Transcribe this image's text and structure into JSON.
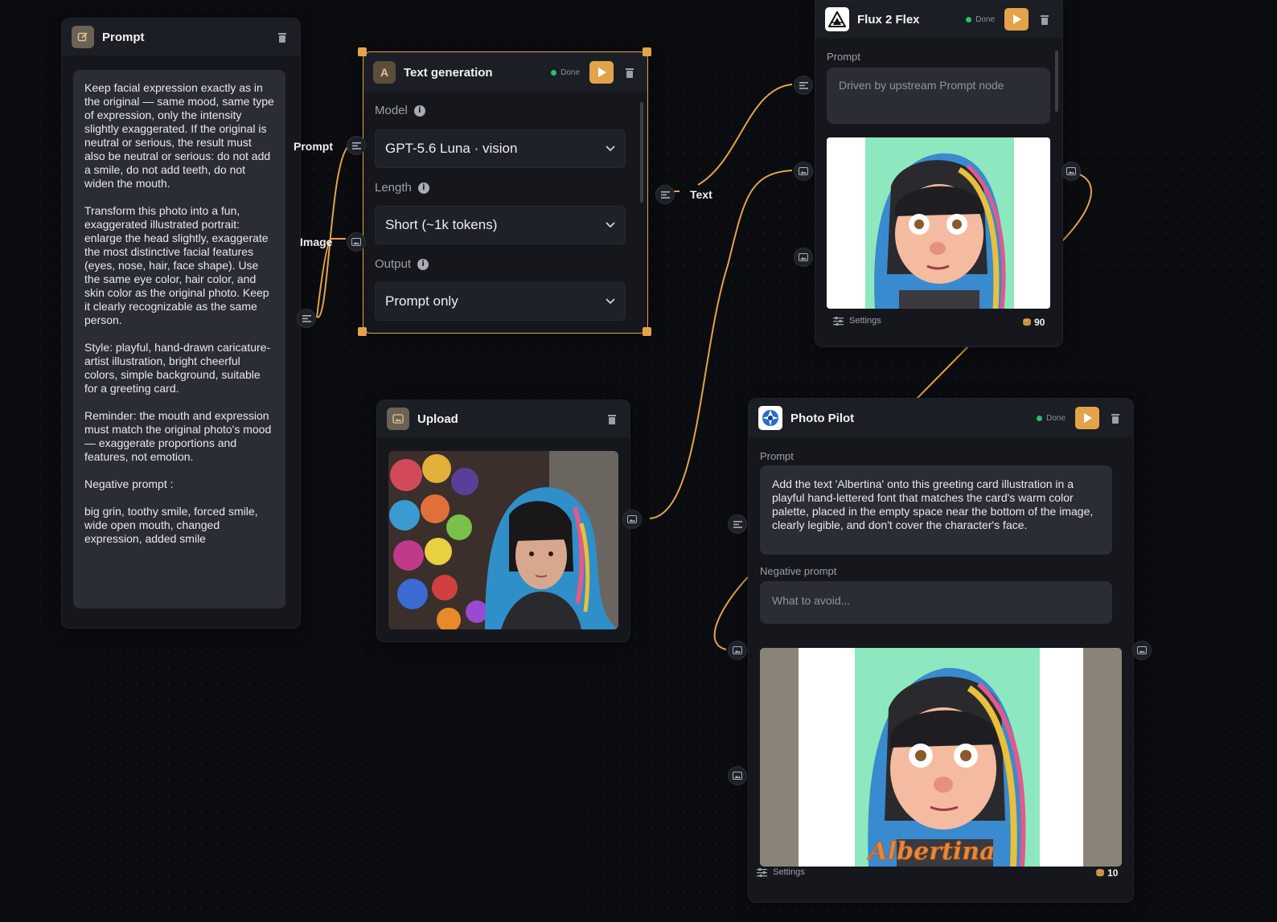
{
  "colors": {
    "accent": "#e3a349",
    "wire": "#e3a349",
    "status_done": "#27c26b",
    "background": "#0b0c10"
  },
  "prompt_node": {
    "title": "Prompt",
    "icon": "edit-icon",
    "paragraphs": [
      "Keep facial expression exactly as in the original — same mood, same type of expression, only the intensity slightly exaggerated. If the original is neutral or serious, the result must also be neutral or serious: do not add a smile, do not add teeth, do not widen the mouth.",
      "Transform this photo into a fun, exaggerated illustrated portrait: enlarge the head slightly, exaggerate the most distinctive facial features (eyes, nose, hair, face shape). Use the same eye color, hair color, and skin color as the original photo. Keep it clearly recognizable as the same person.",
      "Style: playful, hand-drawn caricature-artist illustration, bright cheerful colors, simple background, suitable for a greeting card.",
      "Reminder: the mouth and expression must match the original photo's mood — exaggerate proportions and features, not emotion.",
      "Negative prompt :",
      "big grin, toothy smile, forced smile, wide open mouth, changed expression, added smile"
    ]
  },
  "text_gen_node": {
    "title": "Text generation",
    "icon_letter": "A",
    "status": "Done",
    "inputs": {
      "prompt_label": "Prompt",
      "image_label": "Image"
    },
    "output_label": "Text",
    "model": {
      "label": "Model",
      "value": "GPT-5.6 Luna · vision"
    },
    "length": {
      "label": "Length",
      "value": "Short (~1k tokens)"
    },
    "output": {
      "label": "Output",
      "value": "Prompt only"
    }
  },
  "upload_node": {
    "title": "Upload",
    "icon": "image-icon"
  },
  "flux_node": {
    "title": "Flux 2 Flex",
    "status": "Done",
    "prompt_label": "Prompt",
    "prompt_placeholder": "Driven by upstream Prompt node",
    "settings_label": "Settings",
    "credits": "90"
  },
  "photopilot_node": {
    "title": "Photo Pilot",
    "status": "Done",
    "prompt_label": "Prompt",
    "prompt_value": "Add the text 'Albertina' onto this greeting card illustration in a playful hand-lettered font that matches the card's warm color palette, placed in the empty space near the bottom of the image, clearly legible, and don't cover the character's face.",
    "negative_label": "Negative prompt",
    "negative_placeholder": "What to avoid...",
    "image_caption": "Albertina",
    "settings_label": "Settings",
    "credits": "10"
  }
}
